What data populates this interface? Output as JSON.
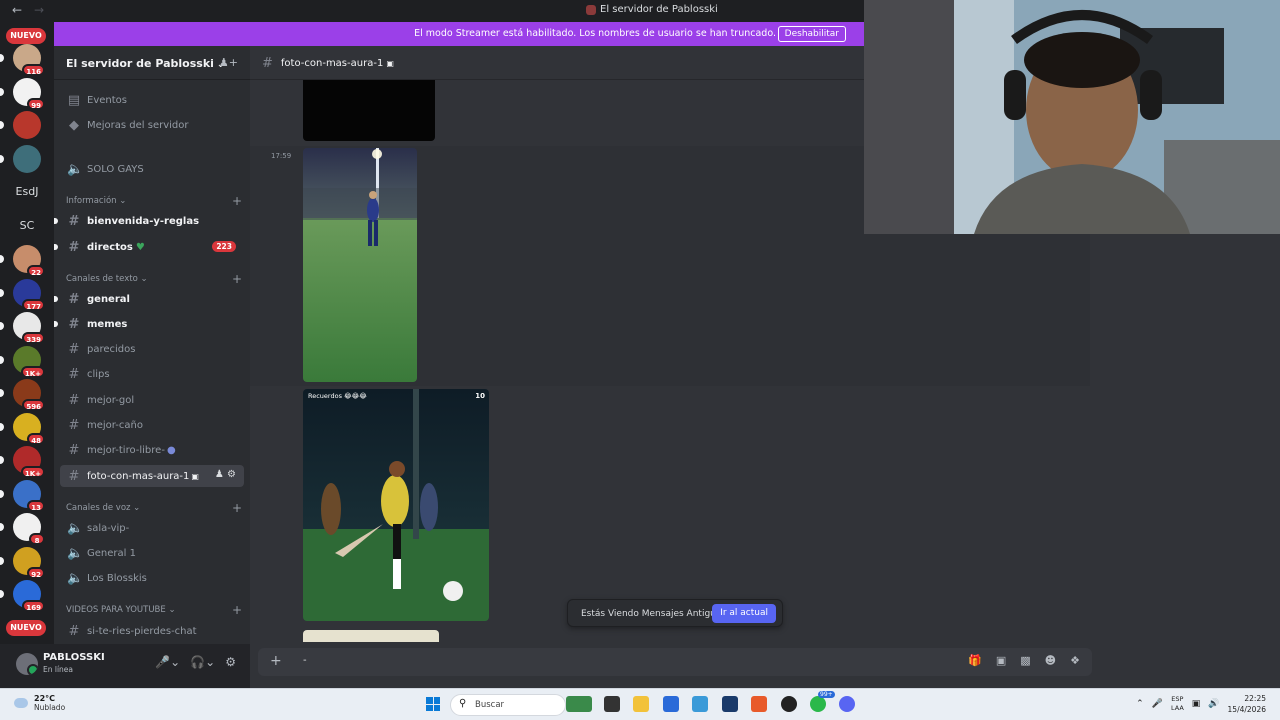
{
  "window": {
    "title": "El servidor de Pablosski"
  },
  "rail": {
    "new_label": "NUEVO",
    "servers": [
      {
        "badge": "116",
        "color": "#c9a889"
      },
      {
        "badge": "99",
        "color": "#f2f2f2"
      },
      {
        "badge": "",
        "color": "#b8372c"
      },
      {
        "badge": "",
        "color": "#3e6e7a"
      },
      {
        "text": "EsdJ"
      },
      {
        "text": "SC"
      },
      {
        "badge": "22",
        "color": "#c78d6b"
      },
      {
        "badge": "177",
        "color": "#2a3a9a"
      },
      {
        "badge": "339",
        "color": "#e8e8e8"
      },
      {
        "badge": "1K+",
        "color": "#5a7a2a"
      },
      {
        "badge": "596",
        "color": "#8a3a1a"
      },
      {
        "badge": "48",
        "color": "#d8b020"
      },
      {
        "badge": "1K+",
        "color": "#b02a2a"
      },
      {
        "badge": "13",
        "color": "#3a70c8"
      },
      {
        "badge": "8",
        "color": "#f0f0f0"
      },
      {
        "badge": "92",
        "color": "#d0a020"
      },
      {
        "badge": "169",
        "color": "#2a6ad8"
      }
    ]
  },
  "banner": {
    "text": "El modo Streamer está habilitado. Los nombres de usuario se han truncado.",
    "button": "Deshabilitar"
  },
  "sidebar": {
    "server_name": "El servidor de Pablosski",
    "top_items": [
      {
        "label": "Eventos",
        "icon": "calendar-icon"
      },
      {
        "label": "Mejoras del servidor",
        "icon": "boost-icon"
      },
      {
        "label": "SOLO GAYS",
        "icon": "speaker-icon"
      }
    ],
    "categories": {
      "info": "Información",
      "text": "Canales de texto",
      "voice": "Canales de voz",
      "youtube": "VIDEOS PARA YOUTUBE"
    },
    "info_channels": [
      {
        "label": "bienvenida-y-reglas"
      },
      {
        "label": "directos",
        "badge": "223"
      }
    ],
    "text_channels": [
      {
        "label": "general"
      },
      {
        "label": "memes"
      },
      {
        "label": "parecidos"
      },
      {
        "label": "clips"
      },
      {
        "label": "mejor-gol"
      },
      {
        "label": "mejor-caño"
      },
      {
        "label": "mejor-tiro-libre-"
      },
      {
        "label": "foto-con-mas-aura-1"
      }
    ],
    "voice_channels": [
      {
        "label": "sala-vip-"
      },
      {
        "label": "General 1"
      },
      {
        "label": "Los Blosskis"
      }
    ],
    "youtube_channels": [
      {
        "label": "si-te-ries-pierdes-chat"
      }
    ]
  },
  "user": {
    "name": "PABLOSSKI",
    "status": "En línea"
  },
  "chat": {
    "channel": "foto-con-mas-aura-1",
    "timestamp": "17:59",
    "kick_caption": "Recuerdos 😂😂😂",
    "kick_logo": "10",
    "old_messages_text": "Estás Viendo Mensajes Antiguos",
    "jump_button": "Ir al actual",
    "composer_text": "-"
  },
  "taskbar": {
    "temp": "22°C",
    "weather": "Nublado",
    "search": "Buscar",
    "lang1": "ESP",
    "lang2": "LAA",
    "time": "22:25",
    "date": "15/4/2026",
    "discord_badge": "99+"
  }
}
